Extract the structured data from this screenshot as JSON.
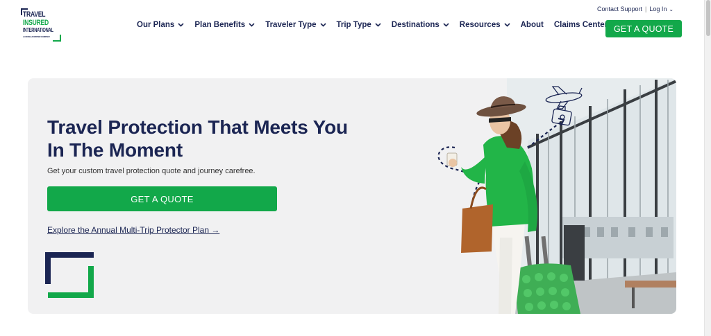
{
  "brand": {
    "line1": "TRAVEL",
    "line2": "INSURED",
    "line3": "INTERNATIONAL",
    "line4": "A CRUM & FORSTER COMPANY",
    "navy": "#1b2553",
    "green": "#12a84a"
  },
  "top_links": {
    "contact": "Contact Support",
    "separator": "|",
    "login": "Log In"
  },
  "nav": {
    "items": [
      {
        "label": "Our Plans",
        "dropdown": true
      },
      {
        "label": "Plan Benefits",
        "dropdown": true
      },
      {
        "label": "Traveler Type",
        "dropdown": true
      },
      {
        "label": "Trip Type",
        "dropdown": true
      },
      {
        "label": "Destinations",
        "dropdown": true
      },
      {
        "label": "Resources",
        "dropdown": true
      },
      {
        "label": "About",
        "dropdown": false
      },
      {
        "label": "Claims Center",
        "dropdown": false
      }
    ],
    "cta": "GET A QUOTE"
  },
  "hero": {
    "title": "Travel Protection That Meets You In The Moment",
    "subtitle": "Get your custom travel protection quote and journey carefree.",
    "cta": "GET A QUOTE",
    "link": "Explore the Annual Multi-Trip Protector Plan →"
  }
}
